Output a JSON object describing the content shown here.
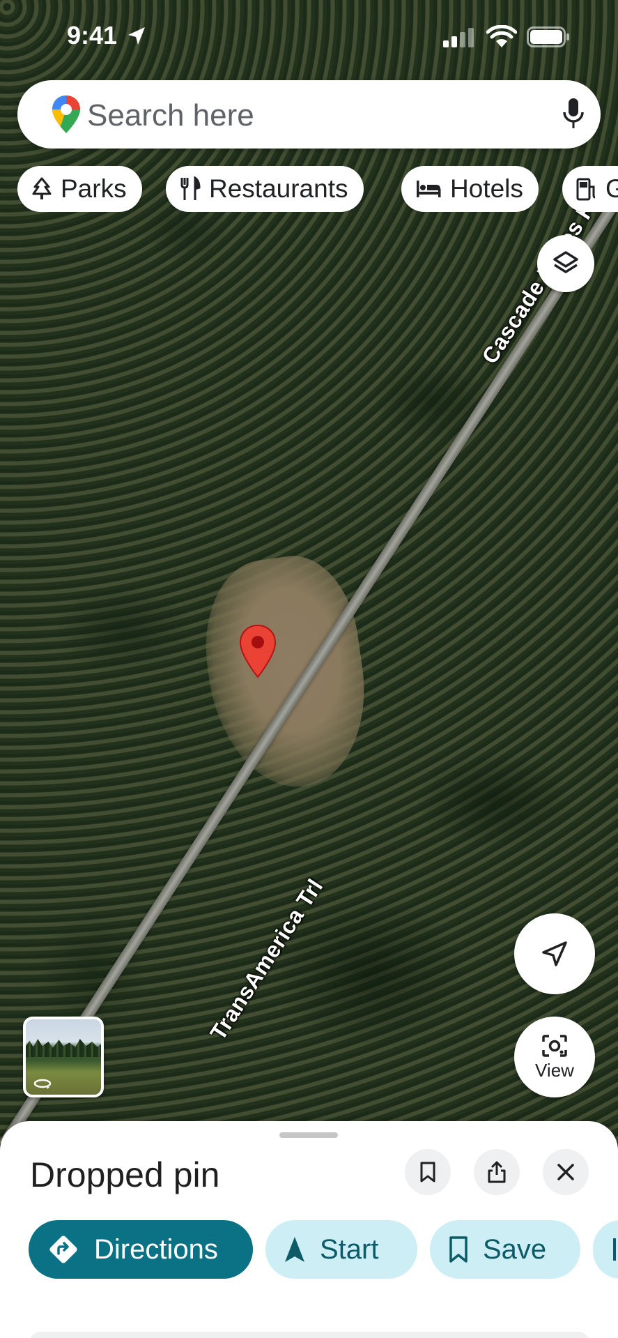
{
  "status_bar": {
    "time": "9:41"
  },
  "search": {
    "placeholder": "Search here"
  },
  "chips": [
    {
      "label": "Parks",
      "icon": "tree-icon"
    },
    {
      "label": "Restaurants",
      "icon": "fork-knife-icon"
    },
    {
      "label": "Hotels",
      "icon": "bed-icon"
    },
    {
      "label": "G",
      "icon": "gas-station-icon"
    }
  ],
  "map": {
    "road_labels": [
      "Cascade Lakes H",
      "TransAmerica Trl"
    ]
  },
  "floating": {
    "lens_label": "View"
  },
  "sheet": {
    "title": "Dropped pin",
    "actions": {
      "directions": "Directions",
      "start": "Start",
      "save": "Save"
    }
  },
  "colors": {
    "pin_red": "#ea4335",
    "directions_teal": "#0b7285",
    "secondary_btn_bg": "#cdeef5",
    "secondary_btn_text": "#0c5b67"
  }
}
